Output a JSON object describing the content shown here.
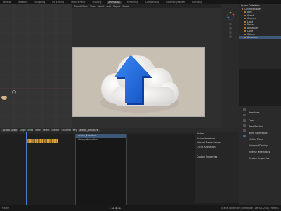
{
  "topbar": {
    "items": [
      "Layout",
      "Modeling",
      "Sculpting",
      "UV Editing",
      "Texture Paint",
      "Shading",
      "Animation",
      "Rendering",
      "Compositing",
      "Geometry Nodes",
      "Scripting"
    ],
    "active_index": 6
  },
  "viewport": {
    "header_items": [
      "Object Mode",
      "View",
      "Select",
      "Add",
      "Object"
    ],
    "label": "Global"
  },
  "scene_collection": {
    "title": "Scene Collection",
    "items": [
      {
        "label": "Collection BDR",
        "selected": false
      },
      {
        "label": "Arm",
        "selected": false
      },
      {
        "label": "Cloud",
        "selected": false
      },
      {
        "label": "Camera",
        "selected": false
      },
      {
        "label": "Light",
        "selected": false
      },
      {
        "label": "Plane",
        "selected": false
      },
      {
        "label": "Armature",
        "selected": false
      },
      {
        "label": "Cube",
        "selected": false
      },
      {
        "label": "Sphere",
        "selected": false
      },
      {
        "label": "Armature",
        "selected": true
      }
    ]
  },
  "timeline": {
    "header_items": [
      "Dope Sheet",
      "View",
      "Select",
      "Marker",
      "Channel",
      "Key"
    ],
    "mode_label": "Action Editor",
    "action_name": "action_Armature",
    "list_items": [
      "action_Armature",
      "Cloudy Animation"
    ]
  },
  "action_panel": {
    "title": "Action",
    "rows": [
      "Action Armature",
      "Manual Frame Range",
      "Cyclic Animation",
      "Custom Properties"
    ]
  },
  "properties": {
    "object_name": "Armature",
    "rows": [
      "Pose",
      "Pose Position",
      "Bone Collections",
      "Motion Paths",
      "Viewport Display",
      "Inverse Kinematics",
      "Custom Properties"
    ]
  },
  "statusbar": {
    "left": "Frame",
    "right": "Scene Collection | Armature | Verts 1,254 | Frame 1"
  },
  "colors": {
    "arrow_blue": "#1f6fe0",
    "cloud_white": "#f3f2f1",
    "camera_bg": "#c8bfb3",
    "accent_orange": "#e08c2c",
    "selection_blue": "#3e5878"
  }
}
